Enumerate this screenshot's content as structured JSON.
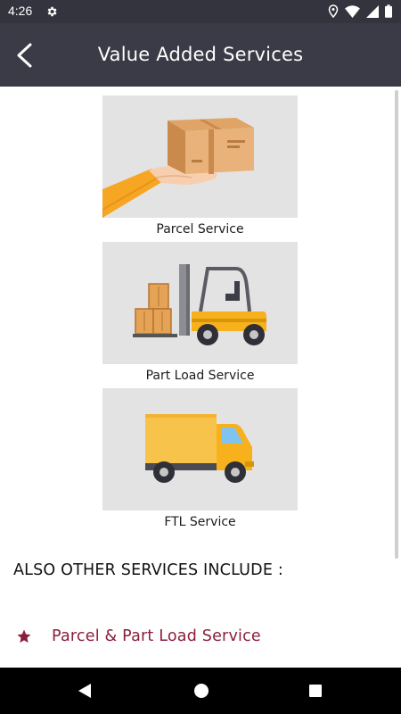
{
  "status_bar": {
    "time": "4:26",
    "icons": [
      "gear-icon",
      "location-icon",
      "wifi-icon",
      "signal-icon",
      "battery-icon"
    ]
  },
  "app_bar": {
    "title": "Value Added Services",
    "back_icon": "back-arrow-icon"
  },
  "services": [
    {
      "caption": "Parcel Service",
      "image": "parcel-hand-illustration"
    },
    {
      "caption": "Part Load Service",
      "image": "forklift-illustration"
    },
    {
      "caption": "FTL Service",
      "image": "truck-illustration"
    }
  ],
  "also_header": "ALSO OTHER SERVICES INCLUDE :",
  "other_services": [
    {
      "label": "Parcel & Part Load Service",
      "icon": "star-icon"
    }
  ],
  "colors": {
    "status_bar": "#34343f",
    "app_bar": "#3a3b46",
    "accent": "#8a1e3c",
    "card_bg": "#e3e3e3"
  },
  "nav_bar": {
    "buttons": [
      "back-triangle-icon",
      "home-circle-icon",
      "recents-square-icon"
    ]
  }
}
